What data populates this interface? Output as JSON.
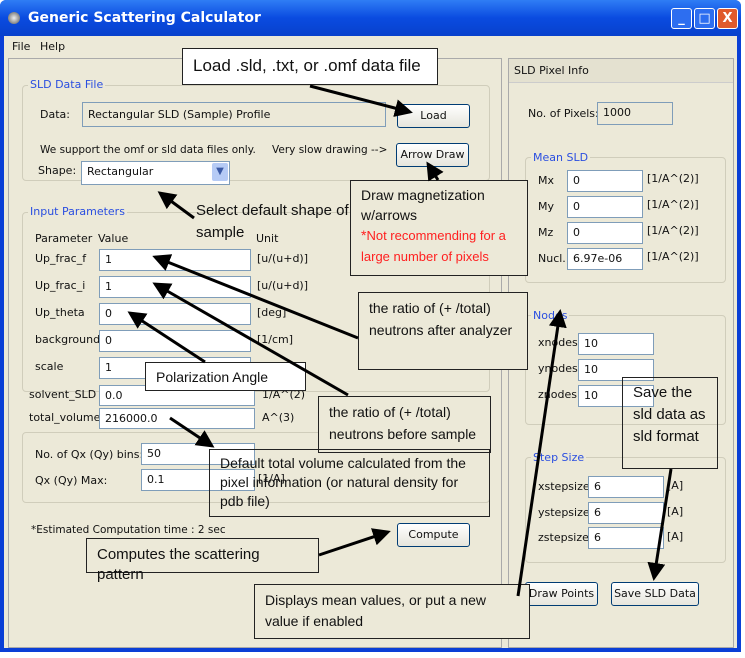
{
  "window": {
    "title": "Generic Scattering Calculator",
    "minimize": "_",
    "maximize": "□",
    "close": "X"
  },
  "menu": [
    "File",
    "Help"
  ],
  "sld_data_file": {
    "group_label": "SLD Data File",
    "data_label": "Data:",
    "data_value": "Rectangular SLD (Sample) Profile",
    "load_button": "Load",
    "support_text": "We support the omf or sld data files only.",
    "slow_text": "Very slow drawing -->",
    "arrow_draw_button": "Arrow Draw",
    "shape_label": "Shape:",
    "shape_value": "Rectangular"
  },
  "input_parameters": {
    "group_label": "Input Parameters",
    "headers": {
      "parameter": "Parameter",
      "value": "Value",
      "unit": "Unit"
    },
    "rows": [
      {
        "name": "Up_frac_f",
        "value": "1",
        "unit": "[u/(u+d)]"
      },
      {
        "name": "Up_frac_i",
        "value": "1",
        "unit": "[u/(u+d)]"
      },
      {
        "name": "Up_theta",
        "value": "0",
        "unit": "[deg]"
      },
      {
        "name": "background",
        "value": "0",
        "unit": "[1/cm]"
      },
      {
        "name": "scale",
        "value": "1",
        "unit": ""
      }
    ],
    "solvent_sld": {
      "name": "solvent_SLD",
      "value": "0.0",
      "unit": "1/A^(2)"
    },
    "total_volume": {
      "name": "total_volume",
      "value": "216000.0",
      "unit": "A^(3)"
    }
  },
  "q_settings": {
    "bins_label": "No. of Qx (Qy) bins:",
    "bins_value": "50",
    "qmax_label": "Qx (Qy) Max:",
    "qmax_value": "0.1",
    "qmax_unit": "[1/A]"
  },
  "estimated_time": "*Estimated Computation time : 2 sec",
  "compute_button": "Compute",
  "pixel_info": {
    "header": "SLD Pixel Info",
    "num_pixels_label": "No. of Pixels:",
    "num_pixels_value": "1000",
    "mean_sld": {
      "group_label": "Mean SLD",
      "rows": [
        {
          "name": "Mx",
          "value": "0",
          "unit": "[1/A^(2)]"
        },
        {
          "name": "My",
          "value": "0",
          "unit": "[1/A^(2)]"
        },
        {
          "name": "Mz",
          "value": "0",
          "unit": "[1/A^(2)]"
        },
        {
          "name": "Nucl.",
          "value": "6.97e-06",
          "unit": "[1/A^(2)]"
        }
      ]
    },
    "nodes": {
      "group_label": "Nodes",
      "rows": [
        {
          "name": "xnodes",
          "value": "10"
        },
        {
          "name": "ynodes",
          "value": "10"
        },
        {
          "name": "znodes",
          "value": "10"
        }
      ]
    },
    "step_size": {
      "group_label": "Step Size",
      "rows": [
        {
          "name": "xstepsize",
          "value": "6",
          "unit": "[A]"
        },
        {
          "name": "ystepsize",
          "value": "6",
          "unit": "[A]"
        },
        {
          "name": "zstepsize",
          "value": "6",
          "unit": "[A]"
        }
      ]
    },
    "draw_points_button": "Draw Points",
    "save_sld_button": "Save SLD Data"
  },
  "annotations": {
    "load": "Load .sld, .txt,  or .omf data file",
    "arrow_draw_1": "Draw magnetization w/arrows",
    "arrow_draw_star": "*",
    "arrow_draw_2": "Not recommending for a large number of pixels",
    "shape": "Select default shape of sample",
    "ratio_after": "the ratio of (+ /total) neutrons after analyzer",
    "polarization": "Polarization Angle",
    "ratio_before": "the ratio of (+ /total) neutrons before sample",
    "total_volume": "Default total volume  calculated from the pixel information (or natural density for pdb file)",
    "compute": "Computes the scattering pattern",
    "mean_values": "Displays mean values, or put a new value if enabled",
    "save": "Save the sld data as sld format"
  }
}
